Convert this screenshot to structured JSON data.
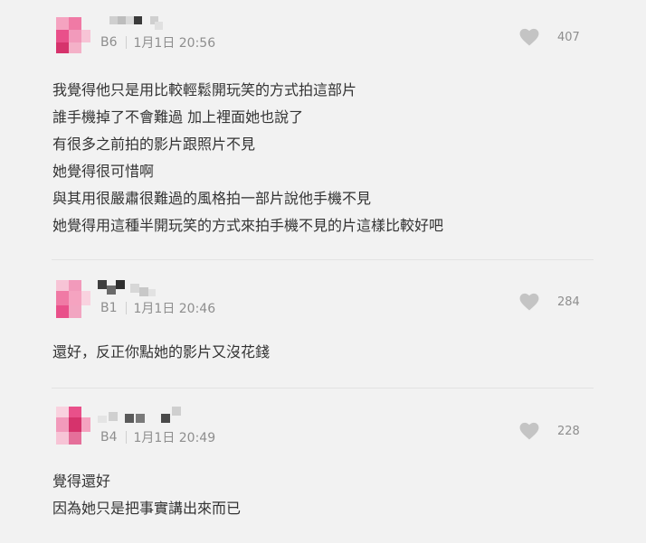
{
  "comments": [
    {
      "floor": "B6",
      "date": "1月1日 20:56",
      "likes": "407",
      "lines": [
        "我覺得他只是用比較輕鬆開玩笑的方式拍這部片",
        "誰手機掉了不會難過 加上裡面她也說了",
        "有很多之前拍的影片跟照片不見",
        "她覺得很可惜啊",
        "與其用很嚴肅很難過的風格拍一部片說他手機不見",
        "她覺得用這種半開玩笑的方式來拍手機不見的片這樣比較好吧"
      ]
    },
    {
      "floor": "B1",
      "date": "1月1日 20:46",
      "likes": "284",
      "lines": [
        "還好，反正你點她的影片又沒花錢"
      ]
    },
    {
      "floor": "B4",
      "date": "1月1日 20:49",
      "likes": "228",
      "lines": [
        "覺得還好",
        "因為她只是把事實講出來而已"
      ]
    }
  ],
  "icons": {
    "like": "heart-icon",
    "avatar": "pixelated-avatar"
  },
  "colors": {
    "background": "#f2f2f2",
    "text": "#333333",
    "meta_text": "#8e8e8e",
    "heart": "#c4c4c4",
    "avatar_pink": "#e56f9a",
    "avatar_deep": "#d6336c"
  }
}
